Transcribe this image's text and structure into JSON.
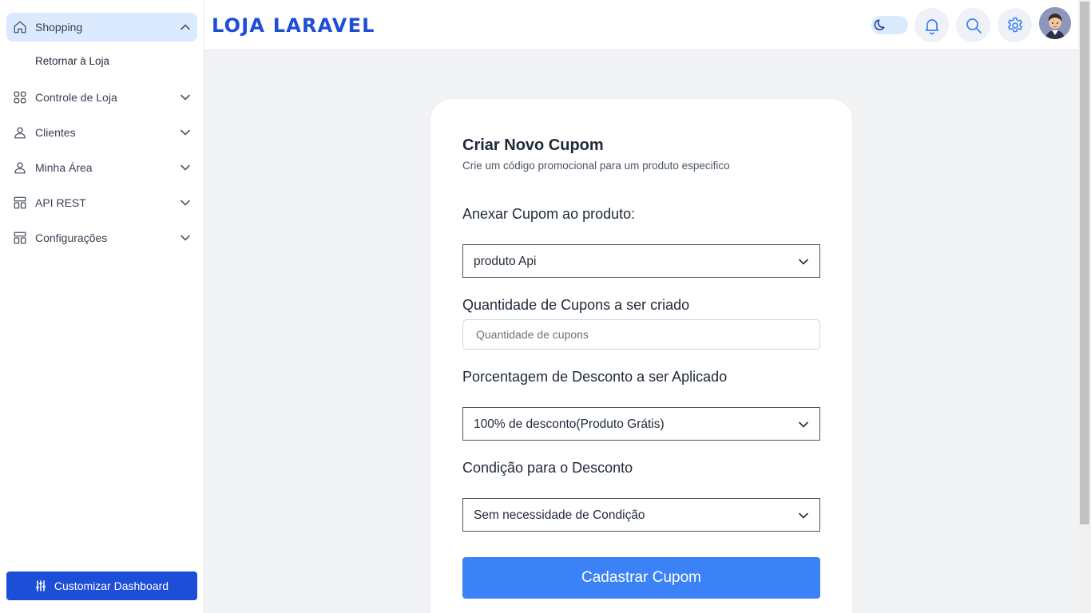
{
  "sidebar": {
    "items": [
      {
        "label": "Shopping",
        "icon": "home-icon"
      },
      {
        "label": "Controle de Loja",
        "icon": "grid-icon"
      },
      {
        "label": "Clientes",
        "icon": "user-icon"
      },
      {
        "label": "Minha Área",
        "icon": "user-icon"
      },
      {
        "label": "API REST",
        "icon": "layout-icon"
      },
      {
        "label": "Configurações",
        "icon": "layout-icon"
      }
    ],
    "subitem": "Retornar à Loja",
    "customize_label": "Customizar Dashboard"
  },
  "header": {
    "brand": "LOJA LARAVEL"
  },
  "form": {
    "title": "Criar Novo Cupom",
    "subtitle": "Crie um código promocional para um produto especifico",
    "product_label": "Anexar Cupom ao produto:",
    "product_value": "produto Api",
    "quantity_label": "Quantidade de Cupons a ser criado",
    "quantity_placeholder": "Quantidade de cupons",
    "discount_label": "Porcentagem de Desconto a ser Aplicado",
    "discount_value": "100% de desconto(Produto Grátis)",
    "condition_label": "Condição para o Desconto",
    "condition_value": "Sem necessidade de Condição",
    "submit_label": "Cadastrar Cupom"
  },
  "colors": {
    "brand": "#1d4ed8",
    "active_bg": "#dbeafe",
    "button": "#3b82f6",
    "customize_button": "#1d4ed8"
  }
}
